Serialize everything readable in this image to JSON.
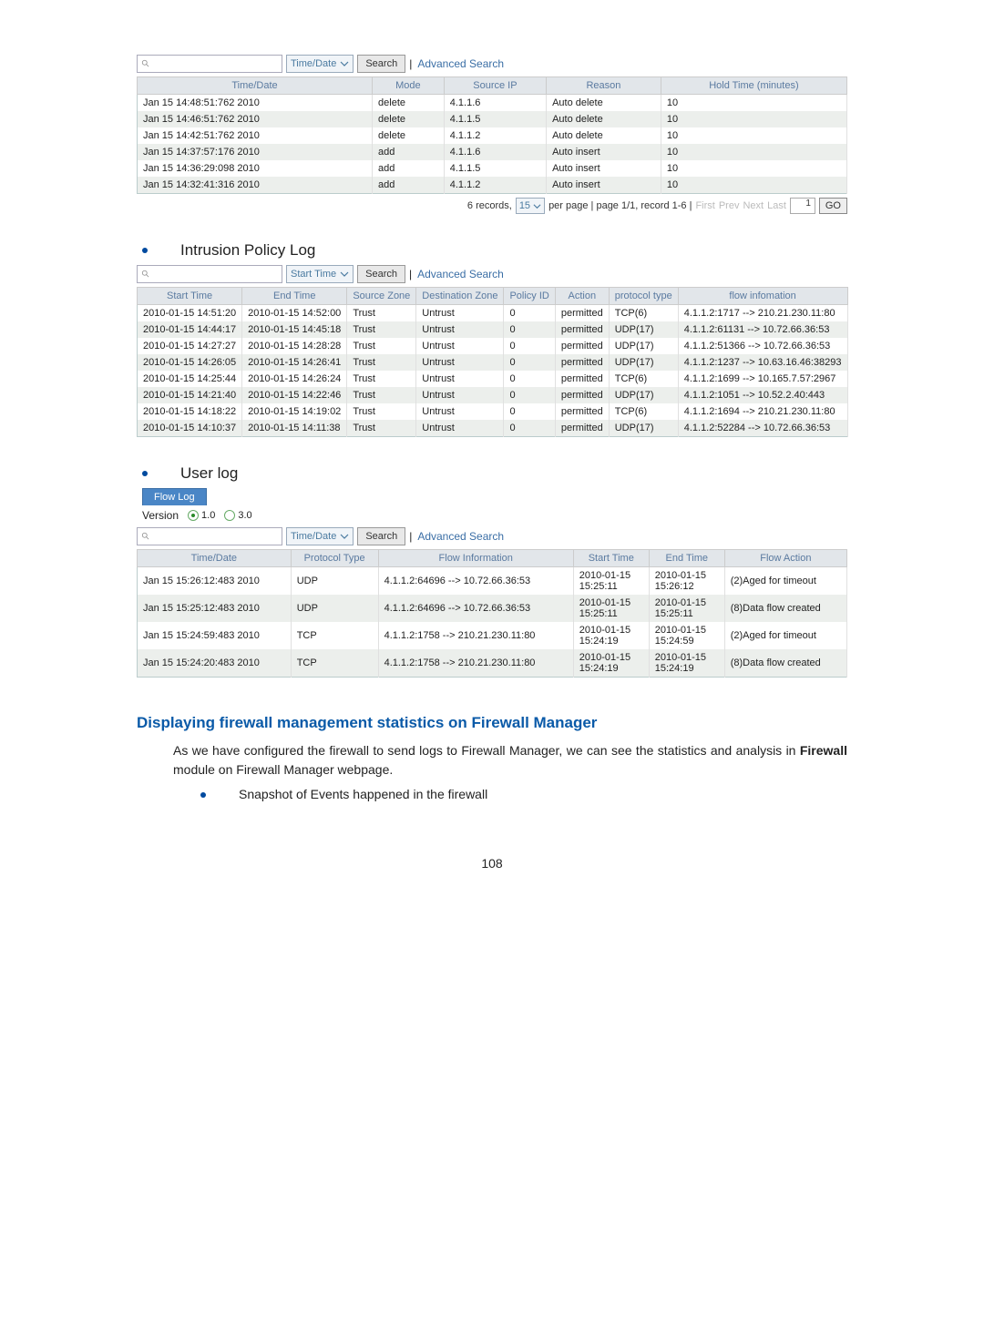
{
  "log1": {
    "search_placeholder": "",
    "dropdown_label": "Time/Date",
    "search_btn": "Search",
    "advanced": "Advanced Search",
    "headers": [
      "Time/Date",
      "Mode",
      "Source IP",
      "Reason",
      "Hold Time (minutes)"
    ],
    "rows": [
      [
        "Jan 15 14:48:51:762 2010",
        "delete",
        "4.1.1.6",
        "Auto delete",
        "10"
      ],
      [
        "Jan 15 14:46:51:762 2010",
        "delete",
        "4.1.1.5",
        "Auto delete",
        "10"
      ],
      [
        "Jan 15 14:42:51:762 2010",
        "delete",
        "4.1.1.2",
        "Auto delete",
        "10"
      ],
      [
        "Jan 15 14:37:57:176 2010",
        "add",
        "4.1.1.6",
        "Auto insert",
        "10"
      ],
      [
        "Jan 15 14:36:29:098 2010",
        "add",
        "4.1.1.5",
        "Auto insert",
        "10"
      ],
      [
        "Jan 15 14:32:41:316 2010",
        "add",
        "4.1.1.2",
        "Auto insert",
        "10"
      ]
    ],
    "pager_records": "6 records,",
    "pager_pp_value": "15",
    "pager_middle": "per page | page 1/1, record 1-6 |",
    "pager_first": "First",
    "pager_prev": "Prev",
    "pager_next": "Next",
    "pager_last": "Last",
    "pager_go_val": "1",
    "pager_go": "GO"
  },
  "section_intrusion": {
    "title": "Intrusion Policy Log"
  },
  "log2": {
    "dropdown_label": "Start Time",
    "search_btn": "Search",
    "advanced": "Advanced Search",
    "headers": [
      "Start Time",
      "End Time",
      "Source Zone",
      "Destination Zone",
      "Policy ID",
      "Action",
      "protocol type",
      "flow infomation"
    ],
    "rows": [
      [
        "2010-01-15 14:51:20",
        "2010-01-15 14:52:00",
        "Trust",
        "Untrust",
        "0",
        "permitted",
        "TCP(6)",
        "4.1.1.2:1717 --> 210.21.230.11:80"
      ],
      [
        "2010-01-15 14:44:17",
        "2010-01-15 14:45:18",
        "Trust",
        "Untrust",
        "0",
        "permitted",
        "UDP(17)",
        "4.1.1.2:61131 --> 10.72.66.36:53"
      ],
      [
        "2010-01-15 14:27:27",
        "2010-01-15 14:28:28",
        "Trust",
        "Untrust",
        "0",
        "permitted",
        "UDP(17)",
        "4.1.1.2:51366 --> 10.72.66.36:53"
      ],
      [
        "2010-01-15 14:26:05",
        "2010-01-15 14:26:41",
        "Trust",
        "Untrust",
        "0",
        "permitted",
        "UDP(17)",
        "4.1.1.2:1237 --> 10.63.16.46:38293"
      ],
      [
        "2010-01-15 14:25:44",
        "2010-01-15 14:26:24",
        "Trust",
        "Untrust",
        "0",
        "permitted",
        "TCP(6)",
        "4.1.1.2:1699 --> 10.165.7.57:2967"
      ],
      [
        "2010-01-15 14:21:40",
        "2010-01-15 14:22:46",
        "Trust",
        "Untrust",
        "0",
        "permitted",
        "UDP(17)",
        "4.1.1.2:1051 --> 10.52.2.40:443"
      ],
      [
        "2010-01-15 14:18:22",
        "2010-01-15 14:19:02",
        "Trust",
        "Untrust",
        "0",
        "permitted",
        "TCP(6)",
        "4.1.1.2:1694 --> 210.21.230.11:80"
      ],
      [
        "2010-01-15 14:10:37",
        "2010-01-15 14:11:38",
        "Trust",
        "Untrust",
        "0",
        "permitted",
        "UDP(17)",
        "4.1.1.2:52284 --> 10.72.66.36:53"
      ]
    ]
  },
  "section_user": {
    "title": "User log"
  },
  "flow": {
    "tab": "Flow Log",
    "version_label": "Version",
    "v1": "1.0",
    "v3": "3.0",
    "dropdown_label": "Time/Date",
    "search_btn": "Search",
    "advanced": "Advanced Search",
    "headers": [
      "Time/Date",
      "Protocol Type",
      "Flow Information",
      "Start Time",
      "End Time",
      "Flow Action"
    ],
    "rows": [
      [
        "Jan 15 15:26:12:483 2010",
        "UDP",
        "4.1.1.2:64696 --> 10.72.66.36:53",
        "2010-01-15 15:25:11",
        "2010-01-15 15:26:12",
        "(2)Aged for timeout"
      ],
      [
        "Jan 15 15:25:12:483 2010",
        "UDP",
        "4.1.1.2:64696 --> 10.72.66.36:53",
        "2010-01-15 15:25:11",
        "2010-01-15 15:25:11",
        "(8)Data flow created"
      ],
      [
        "Jan 15 15:24:59:483 2010",
        "TCP",
        "4.1.1.2:1758 --> 210.21.230.11:80",
        "2010-01-15 15:24:19",
        "2010-01-15 15:24:59",
        "(2)Aged for timeout"
      ],
      [
        "Jan 15 15:24:20:483 2010",
        "TCP",
        "4.1.1.2:1758 --> 210.21.230.11:80",
        "2010-01-15 15:24:19",
        "2010-01-15 15:24:19",
        "(8)Data flow created"
      ]
    ]
  },
  "article": {
    "h2": "Displaying firewall management statistics on Firewall Manager",
    "p": "As we have configured the firewall to send logs to Firewall Manager, we can see the statistics and analysis in ",
    "p_bold": "Firewall",
    "p_tail": " module on Firewall Manager webpage.",
    "bullet": "Snapshot of Events happened in the firewall"
  },
  "page_number": "108"
}
